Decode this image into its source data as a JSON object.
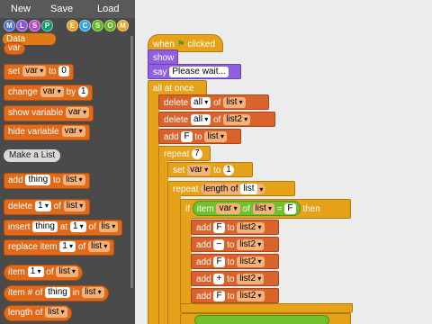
{
  "menu": {
    "new": "New",
    "save": "Save",
    "load": "Load"
  },
  "categories": [
    {
      "letter": "M",
      "color": "#4a6cd4"
    },
    {
      "letter": "L",
      "color": "#8a55d7"
    },
    {
      "letter": "S",
      "color": "#bb42c3"
    },
    {
      "letter": "P",
      "color": "#0e9a6c"
    },
    {
      "letter": "E",
      "color": "#e6a319"
    },
    {
      "letter": "C",
      "color": "#2ca5e2"
    },
    {
      "letter": "S",
      "color": "#5cb712"
    },
    {
      "letter": "O",
      "color": "#5cb712"
    },
    {
      "letter": "M",
      "color": "#e6a319"
    }
  ],
  "data_tab": "Data",
  "palette": {
    "var": "var",
    "set": "set",
    "to": "to",
    "zero": "0",
    "change": "change",
    "by": "by",
    "one": "1",
    "show_variable": "show variable",
    "hide_variable": "hide variable",
    "make_a_list": "Make a List",
    "add": "add",
    "thing": "thing",
    "list": "list",
    "delete": "delete",
    "of": "of",
    "insert": "insert",
    "at": "at",
    "lis": "lis",
    "replace_item": "replace item",
    "item": "item",
    "item_num_of": "item # of",
    "in": "in",
    "length_of": "length of"
  },
  "script": {
    "when": "when",
    "clicked": "clicked",
    "show": "show",
    "say": "say",
    "please_wait": "Please wait...",
    "all_at_once": "all at once",
    "delete": "delete",
    "all": "all",
    "of": "of",
    "list": "list",
    "list2": "list2",
    "add": "add",
    "F": "F",
    "to": "to",
    "repeat": "repeat",
    "seven": "7",
    "set": "set",
    "var": "var",
    "one": "1",
    "length_of": "length of",
    "if": "if",
    "item": "item",
    "eq": "=",
    "then": "then",
    "minus": "−",
    "plus": "+"
  }
}
